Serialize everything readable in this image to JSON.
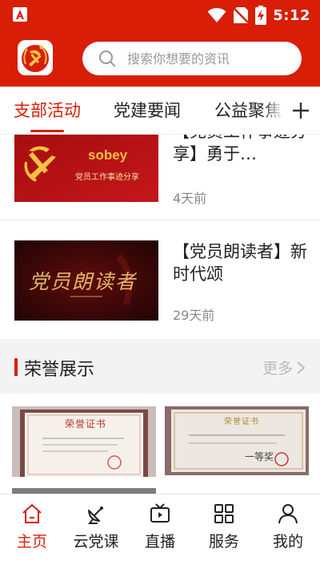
{
  "status_bar": {
    "time": "5:12"
  },
  "search": {
    "placeholder": "搜索你想要的资讯"
  },
  "tabs": [
    {
      "label": "支部活动",
      "active": true
    },
    {
      "label": "党建要闻",
      "active": false
    },
    {
      "label": "公益聚焦",
      "active": false
    }
  ],
  "news": [
    {
      "title": "【党员工作事迹分享】勇于…",
      "time": "4天前",
      "thumb_brand": "sobey",
      "thumb_caption": "党员工作事迹分享"
    },
    {
      "title": "【党员朗读者】新时代颂",
      "time": "29天前",
      "thumb_caption": "党员朗读者"
    }
  ],
  "honor": {
    "title": "荣誉展示",
    "more": "更多",
    "certificates": [
      {
        "heading": "荣誉证书"
      },
      {
        "heading": "荣誉证书",
        "award": "一等奖"
      }
    ]
  },
  "bottom_nav": [
    {
      "label": "主页",
      "icon": "home-icon",
      "active": true
    },
    {
      "label": "云党课",
      "icon": "satellite-dish-icon",
      "active": false
    },
    {
      "label": "直播",
      "icon": "tv-icon",
      "active": false
    },
    {
      "label": "服务",
      "icon": "grid-icon",
      "active": false
    },
    {
      "label": "我的",
      "icon": "user-icon",
      "active": false
    }
  ],
  "colors": {
    "brand_red": "#d81e06",
    "gold": "#f2c54b"
  }
}
